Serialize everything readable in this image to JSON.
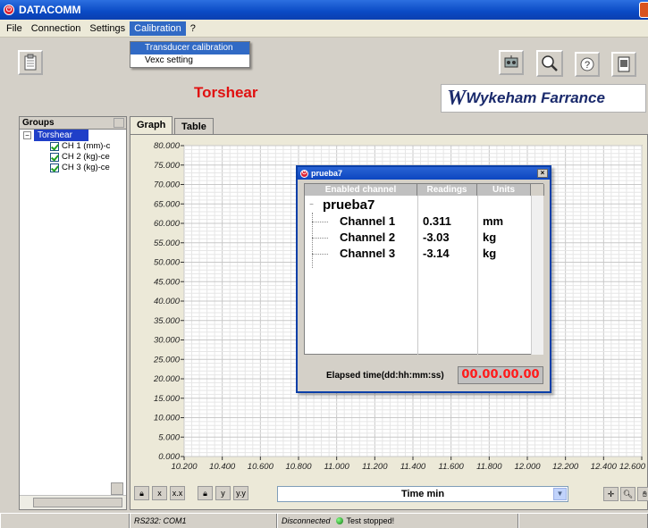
{
  "window": {
    "title": "DATACOMM"
  },
  "menu": {
    "items": [
      "File",
      "Connection",
      "Settings",
      "Calibration",
      "?"
    ],
    "calibration_items": [
      "Transducer calibration",
      "Vexc setting"
    ]
  },
  "header": {
    "title": "Torshear",
    "logo_text": "Wykeham Farrance"
  },
  "groups": {
    "heading": "Groups",
    "root": "Torshear",
    "channels": [
      "CH 1 (mm)-c",
      "CH 2 (kg)-ce",
      "CH 3 (kg)-ce"
    ]
  },
  "tabs": [
    "Graph",
    "Table"
  ],
  "chart_data": {
    "type": "line",
    "x_ticks": [
      "10.200",
      "10.400",
      "10.600",
      "10.800",
      "11.000",
      "11.200",
      "11.400",
      "11.600",
      "11.800",
      "12.000",
      "12.200",
      "12.400",
      "12.600"
    ],
    "y_ticks": [
      "0.000",
      "5.000",
      "10.000",
      "15.000",
      "20.000",
      "25.000",
      "30.000",
      "35.000",
      "40.000",
      "45.000",
      "50.000",
      "55.000",
      "60.000",
      "65.000",
      "70.000",
      "75.000",
      "80.000"
    ],
    "xlim": [
      10.2,
      12.6
    ],
    "ylim": [
      0,
      80
    ],
    "grid": true,
    "series": []
  },
  "x_axis_selector": "Time min",
  "status": {
    "port": "RS232: COM1",
    "connection": "Disconnected",
    "message": "Test stopped!"
  },
  "dialog": {
    "title": "prueba7",
    "columns": [
      "Enabled channel",
      "Readings",
      "Units"
    ],
    "test_name": "prueba7",
    "rows": [
      {
        "channel": "Channel 1",
        "reading": "0.311",
        "unit": "mm"
      },
      {
        "channel": "Channel 2",
        "reading": "-3.03",
        "unit": "kg"
      },
      {
        "channel": "Channel 3",
        "reading": "-3.14",
        "unit": "kg"
      }
    ],
    "elapsed_label": "Elapsed time(dd:hh:mm:ss)",
    "elapsed_value": "00.00.00.00"
  },
  "icons": [
    "clipboard-icon",
    "transducer-icon",
    "magnifier-icon",
    "help-icon",
    "document-icon",
    "lock-icon",
    "zoom-x-icon",
    "zoom-y-icon",
    "crosshair-icon",
    "zoom-icon",
    "pan-icon"
  ],
  "colors": {
    "title_red": "#e01010",
    "selection_blue": "#316ac5",
    "elapsed_red": "#ff1a1a"
  }
}
